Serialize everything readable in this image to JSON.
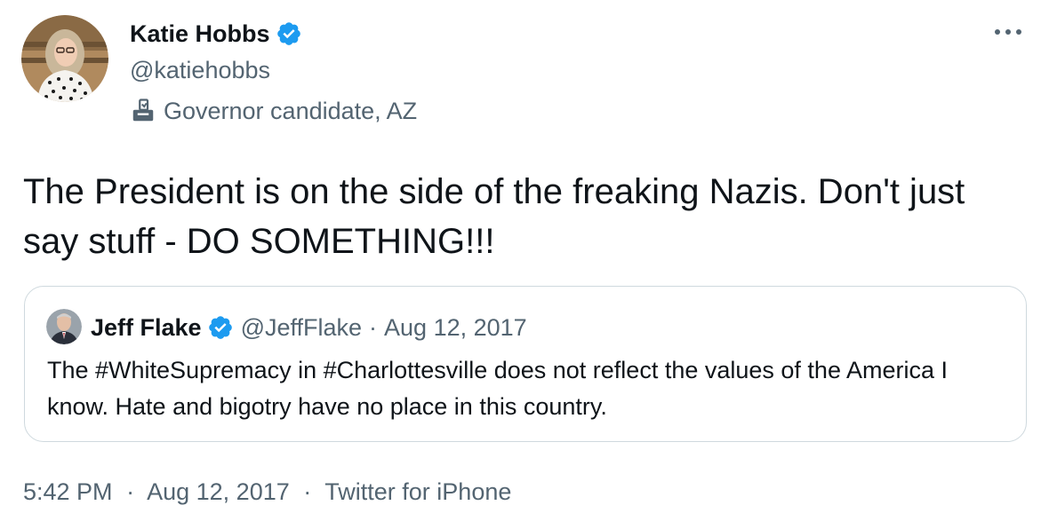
{
  "author": {
    "display_name": "Katie Hobbs",
    "handle": "@katiehobbs",
    "verified": true,
    "label_icon": "ballot-box-icon",
    "label": "Governor candidate, AZ"
  },
  "tweet": {
    "text": "The President is on the side of the freaking Nazis. Don't just say stuff - DO SOMETHING!!!"
  },
  "quoted_tweet": {
    "display_name": "Jeff Flake",
    "verified": true,
    "handle": "@JeffFlake",
    "separator": "·",
    "date": "Aug 12, 2017",
    "text": "The #WhiteSupremacy in #Charlottesville does not reflect the values of the America I know. Hate and bigotry have no place in this country."
  },
  "footer": {
    "time": "5:42 PM",
    "separator": "·",
    "date": "Aug 12, 2017",
    "source": "Twitter for iPhone"
  },
  "colors": {
    "verified_blue": "#1d9bf0",
    "secondary_text": "#536471",
    "border": "#cfd9de",
    "primary_text": "#0f1419"
  }
}
